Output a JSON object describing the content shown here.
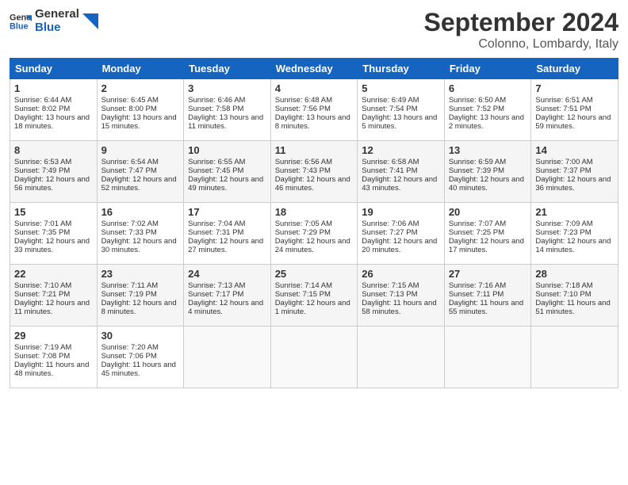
{
  "header": {
    "logo_line1": "General",
    "logo_line2": "Blue",
    "month_year": "September 2024",
    "location": "Colonno, Lombardy, Italy"
  },
  "days_of_week": [
    "Sunday",
    "Monday",
    "Tuesday",
    "Wednesday",
    "Thursday",
    "Friday",
    "Saturday"
  ],
  "weeks": [
    [
      {
        "day": "1",
        "info": "Sunrise: 6:44 AM\nSunset: 8:02 PM\nDaylight: 13 hours and 18 minutes."
      },
      {
        "day": "2",
        "info": "Sunrise: 6:45 AM\nSunset: 8:00 PM\nDaylight: 13 hours and 15 minutes."
      },
      {
        "day": "3",
        "info": "Sunrise: 6:46 AM\nSunset: 7:58 PM\nDaylight: 13 hours and 11 minutes."
      },
      {
        "day": "4",
        "info": "Sunrise: 6:48 AM\nSunset: 7:56 PM\nDaylight: 13 hours and 8 minutes."
      },
      {
        "day": "5",
        "info": "Sunrise: 6:49 AM\nSunset: 7:54 PM\nDaylight: 13 hours and 5 minutes."
      },
      {
        "day": "6",
        "info": "Sunrise: 6:50 AM\nSunset: 7:52 PM\nDaylight: 13 hours and 2 minutes."
      },
      {
        "day": "7",
        "info": "Sunrise: 6:51 AM\nSunset: 7:51 PM\nDaylight: 12 hours and 59 minutes."
      }
    ],
    [
      {
        "day": "8",
        "info": "Sunrise: 6:53 AM\nSunset: 7:49 PM\nDaylight: 12 hours and 56 minutes."
      },
      {
        "day": "9",
        "info": "Sunrise: 6:54 AM\nSunset: 7:47 PM\nDaylight: 12 hours and 52 minutes."
      },
      {
        "day": "10",
        "info": "Sunrise: 6:55 AM\nSunset: 7:45 PM\nDaylight: 12 hours and 49 minutes."
      },
      {
        "day": "11",
        "info": "Sunrise: 6:56 AM\nSunset: 7:43 PM\nDaylight: 12 hours and 46 minutes."
      },
      {
        "day": "12",
        "info": "Sunrise: 6:58 AM\nSunset: 7:41 PM\nDaylight: 12 hours and 43 minutes."
      },
      {
        "day": "13",
        "info": "Sunrise: 6:59 AM\nSunset: 7:39 PM\nDaylight: 12 hours and 40 minutes."
      },
      {
        "day": "14",
        "info": "Sunrise: 7:00 AM\nSunset: 7:37 PM\nDaylight: 12 hours and 36 minutes."
      }
    ],
    [
      {
        "day": "15",
        "info": "Sunrise: 7:01 AM\nSunset: 7:35 PM\nDaylight: 12 hours and 33 minutes."
      },
      {
        "day": "16",
        "info": "Sunrise: 7:02 AM\nSunset: 7:33 PM\nDaylight: 12 hours and 30 minutes."
      },
      {
        "day": "17",
        "info": "Sunrise: 7:04 AM\nSunset: 7:31 PM\nDaylight: 12 hours and 27 minutes."
      },
      {
        "day": "18",
        "info": "Sunrise: 7:05 AM\nSunset: 7:29 PM\nDaylight: 12 hours and 24 minutes."
      },
      {
        "day": "19",
        "info": "Sunrise: 7:06 AM\nSunset: 7:27 PM\nDaylight: 12 hours and 20 minutes."
      },
      {
        "day": "20",
        "info": "Sunrise: 7:07 AM\nSunset: 7:25 PM\nDaylight: 12 hours and 17 minutes."
      },
      {
        "day": "21",
        "info": "Sunrise: 7:09 AM\nSunset: 7:23 PM\nDaylight: 12 hours and 14 minutes."
      }
    ],
    [
      {
        "day": "22",
        "info": "Sunrise: 7:10 AM\nSunset: 7:21 PM\nDaylight: 12 hours and 11 minutes."
      },
      {
        "day": "23",
        "info": "Sunrise: 7:11 AM\nSunset: 7:19 PM\nDaylight: 12 hours and 8 minutes."
      },
      {
        "day": "24",
        "info": "Sunrise: 7:13 AM\nSunset: 7:17 PM\nDaylight: 12 hours and 4 minutes."
      },
      {
        "day": "25",
        "info": "Sunrise: 7:14 AM\nSunset: 7:15 PM\nDaylight: 12 hours and 1 minute."
      },
      {
        "day": "26",
        "info": "Sunrise: 7:15 AM\nSunset: 7:13 PM\nDaylight: 11 hours and 58 minutes."
      },
      {
        "day": "27",
        "info": "Sunrise: 7:16 AM\nSunset: 7:11 PM\nDaylight: 11 hours and 55 minutes."
      },
      {
        "day": "28",
        "info": "Sunrise: 7:18 AM\nSunset: 7:10 PM\nDaylight: 11 hours and 51 minutes."
      }
    ],
    [
      {
        "day": "29",
        "info": "Sunrise: 7:19 AM\nSunset: 7:08 PM\nDaylight: 11 hours and 48 minutes."
      },
      {
        "day": "30",
        "info": "Sunrise: 7:20 AM\nSunset: 7:06 PM\nDaylight: 11 hours and 45 minutes."
      },
      {
        "day": "",
        "info": ""
      },
      {
        "day": "",
        "info": ""
      },
      {
        "day": "",
        "info": ""
      },
      {
        "day": "",
        "info": ""
      },
      {
        "day": "",
        "info": ""
      }
    ]
  ]
}
